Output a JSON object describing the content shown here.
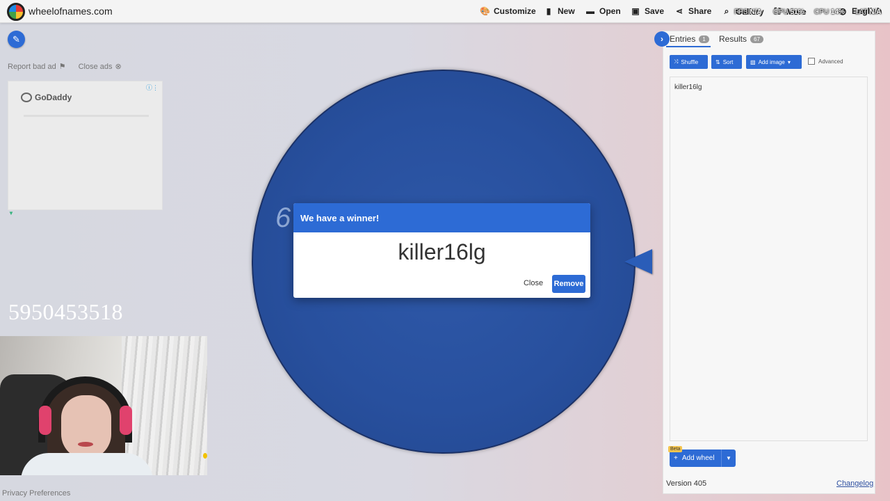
{
  "header": {
    "site_name": "wheelofnames.com",
    "menu": [
      {
        "label": "Customize",
        "icon": "palette-icon"
      },
      {
        "label": "New",
        "icon": "file-icon"
      },
      {
        "label": "Open",
        "icon": "folder-icon"
      },
      {
        "label": "Save",
        "icon": "save-icon"
      },
      {
        "label": "Share",
        "icon": "share-icon"
      },
      {
        "label": "Gallery",
        "icon": "search-icon"
      },
      {
        "label": "More",
        "icon": "fullscreen-icon"
      },
      {
        "label": "English",
        "icon": "globe-icon"
      }
    ],
    "stats_overlay": {
      "fps": "FPS",
      "fps_value": "N/A",
      "gpu": "GPU",
      "gpu_value": "51%",
      "cpu": "CPU",
      "cpu_value": "14%",
      "lat": "LAT",
      "lat_value": "N/A"
    }
  },
  "left": {
    "report_ad": "Report bad ad",
    "close_ads": "Close ads",
    "ad_brand": "GoDaddy",
    "stream_number": "5950453518",
    "privacy": "Privacy Preferences"
  },
  "wheel": {
    "visible_text": "6",
    "color": "#2a55a5"
  },
  "dialog": {
    "title": "We have a winner!",
    "winner": "killer16lg",
    "close_label": "Close",
    "remove_label": "Remove"
  },
  "panel": {
    "tabs": [
      {
        "label": "Entries",
        "count": "1"
      },
      {
        "label": "Results",
        "count": "67"
      }
    ],
    "toolbar": {
      "shuffle": "Shuffle",
      "sort": "Sort",
      "add_image": "Add image",
      "advanced": "Advanced"
    },
    "entries_text": "killer16lg",
    "add_wheel": "Add wheel",
    "beta": "Beta",
    "version": "Version 405",
    "changelog": "Changelog"
  },
  "colors": {
    "accent": "#2d6bd5"
  }
}
